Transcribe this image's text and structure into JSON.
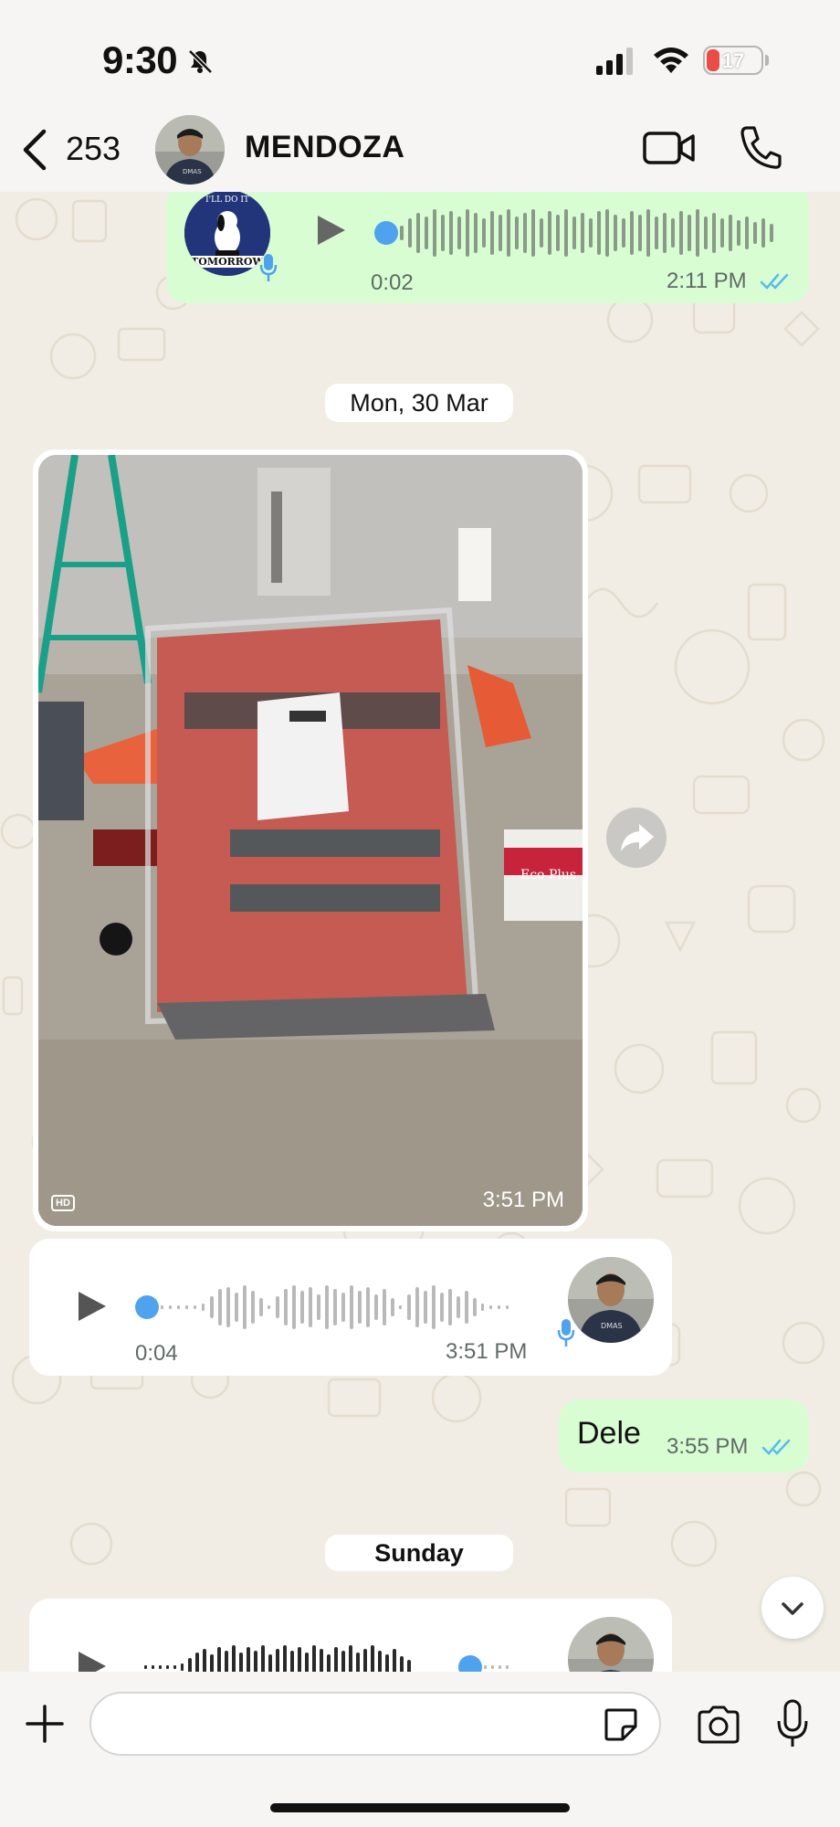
{
  "status": {
    "time": "9:30",
    "battery": "17",
    "icons": [
      "bell-slash-icon",
      "signal-icon",
      "wifi-icon",
      "battery-icon"
    ]
  },
  "header": {
    "back_count": "253",
    "contact_name": "MENDOZA",
    "icons": [
      "chevron-left-icon",
      "video-call-icon",
      "phone-icon"
    ]
  },
  "chat": {
    "voice_out_1": {
      "duration": "0:02",
      "time": "2:11 PM",
      "avatar_caption_top": "I'LL DO IT",
      "avatar_caption_bottom": "TOMORROW"
    },
    "date_1": "Mon, 30 Mar",
    "photo": {
      "time": "3:51 PM",
      "hd_label": "HD",
      "box_label": "Eco Plus"
    },
    "voice_in_1": {
      "duration": "0:04",
      "time": "3:51 PM"
    },
    "text_out": {
      "text": "Dele",
      "time": "3:55 PM"
    },
    "date_2": "Sunday"
  },
  "composer": {
    "placeholder": "",
    "icons": [
      "plus-icon",
      "sticker-icon",
      "camera-icon",
      "microphone-icon"
    ]
  },
  "colors": {
    "outgoing_bubble": "#d9fdd3",
    "incoming_bubble": "#ffffff",
    "read_ticks": "#53bdeb",
    "voice_dot": "#4fa3ee",
    "chat_background": "#f1ede5"
  }
}
